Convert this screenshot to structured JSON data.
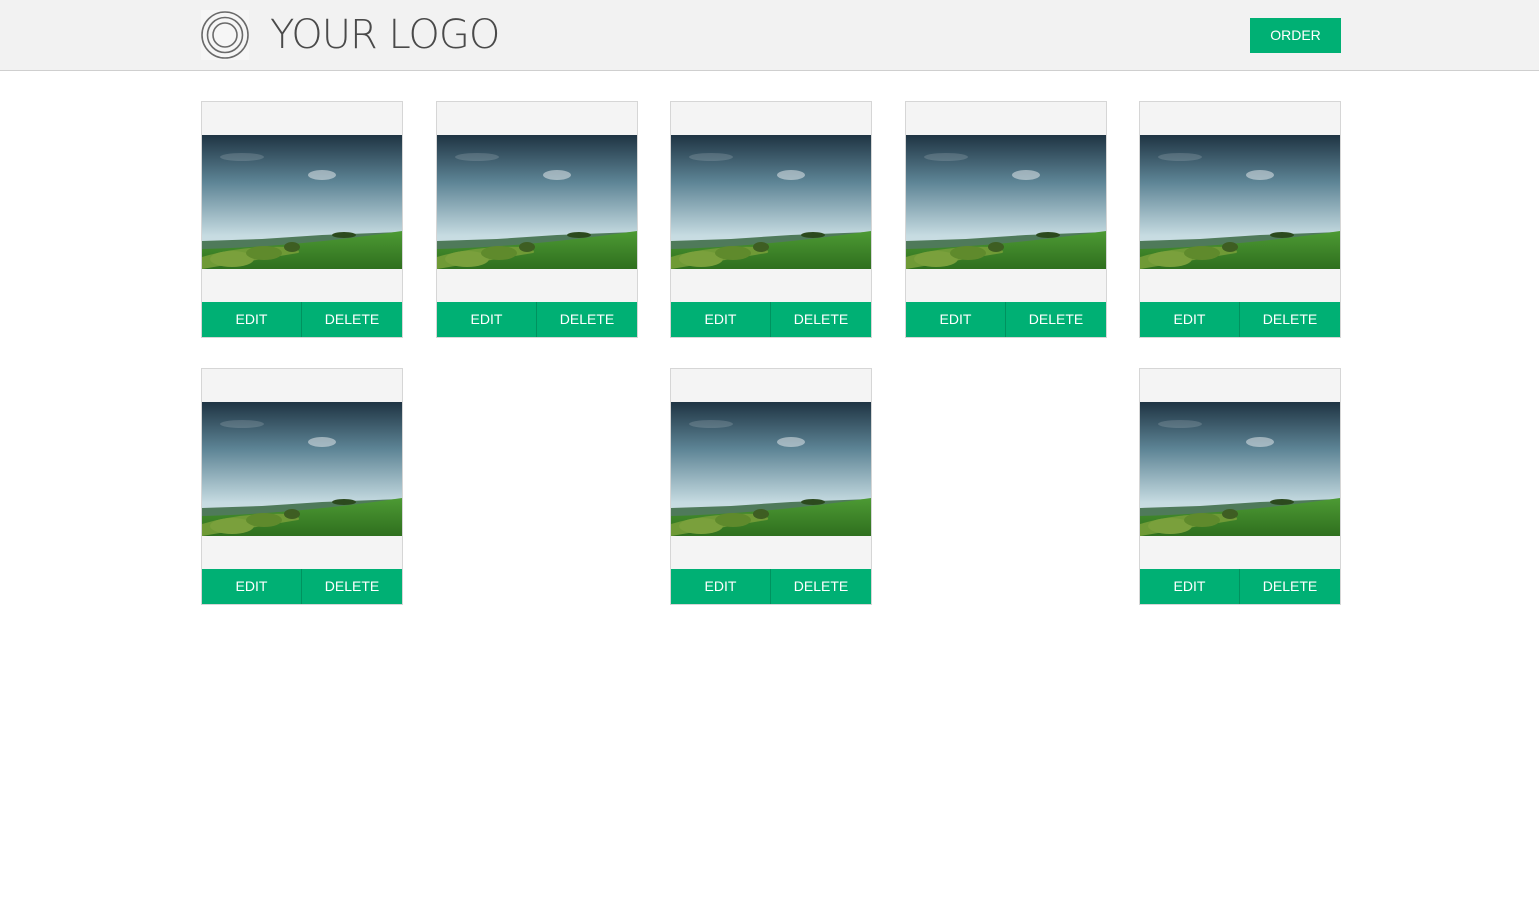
{
  "header": {
    "logo_text": "YOUR LOGO",
    "logo_icon": "concentric-circles-icon",
    "order_label": "ORDER"
  },
  "colors": {
    "accent": "#00b074",
    "header_bg": "#f2f2f2",
    "card_bg": "#f4f4f4",
    "sky_top": "#1f3a4a",
    "sky_bottom": "#c9dde4",
    "grass": "#3f8a2a"
  },
  "cards": [
    {
      "edit_label": "EDIT",
      "delete_label": "DELETE",
      "image": "landscape-photo"
    },
    {
      "edit_label": "EDIT",
      "delete_label": "DELETE",
      "image": "landscape-photo"
    },
    {
      "edit_label": "EDIT",
      "delete_label": "DELETE",
      "image": "landscape-photo"
    },
    {
      "edit_label": "EDIT",
      "delete_label": "DELETE",
      "image": "landscape-photo"
    },
    {
      "edit_label": "EDIT",
      "delete_label": "DELETE",
      "image": "landscape-photo"
    },
    {
      "edit_label": "EDIT",
      "delete_label": "DELETE",
      "image": "landscape-photo"
    },
    {
      "edit_label": "EDIT",
      "delete_label": "DELETE",
      "image": "landscape-photo"
    },
    {
      "edit_label": "EDIT",
      "delete_label": "DELETE",
      "image": "landscape-photo"
    }
  ]
}
